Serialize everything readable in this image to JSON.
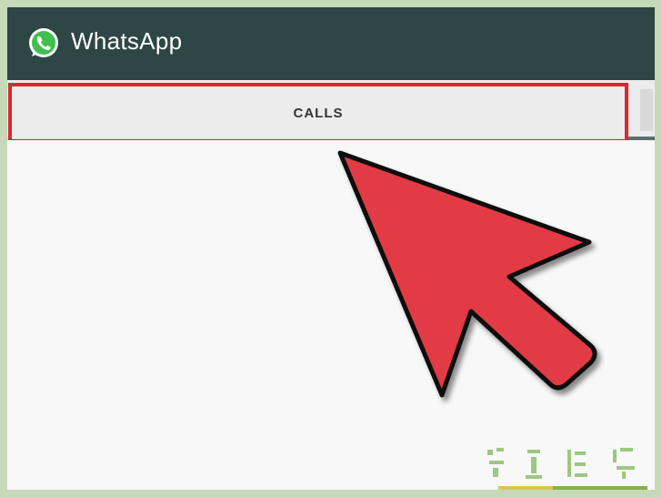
{
  "app": {
    "title": "WhatsApp",
    "logo_icon": "whatsapp-logo-icon",
    "colors": {
      "appbar": "#2e4646",
      "tab_background": "#ececec",
      "highlight": "#e0262f",
      "arrow": "#e23a45"
    }
  },
  "tabs": [
    {
      "label": "CALLS",
      "selected": true
    }
  ],
  "annotation": {
    "arrow_icon": "pointer-arrow-icon",
    "highlight_box": "red-highlight-box"
  }
}
